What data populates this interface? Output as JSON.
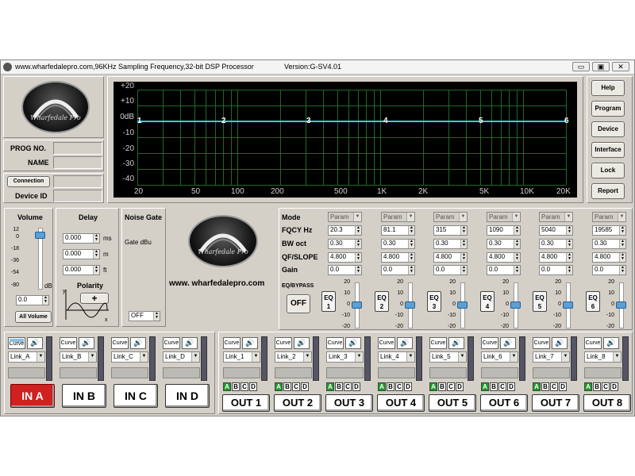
{
  "window": {
    "title": "www.wharfedalepro.com,96KHz Sampling Frequency,32-bit DSP Processor",
    "version": "Version:G-SV4.01",
    "controls": [
      "▭",
      "▣",
      "✕"
    ]
  },
  "left_panel": {
    "logo_text": "Wharfedale Pro",
    "prog_no_label": "PROG NO.",
    "name_label": "NAME",
    "connection_label": "Connection",
    "device_id_label": "Device ID"
  },
  "graph": {
    "y_labels": [
      "+20",
      "+10",
      "0dB",
      "-10",
      "-20",
      "-30",
      "-40"
    ],
    "x_labels": [
      "20",
      "50",
      "100",
      "200",
      "500",
      "1K",
      "2K",
      "5K",
      "10K",
      "20K"
    ],
    "nodes": [
      "1",
      "2",
      "3",
      "4",
      "5",
      "6"
    ],
    "line_color": "#3cc8e0",
    "grid_color": "#1c6a2a"
  },
  "right_buttons": [
    "Help",
    "Program",
    "Device",
    "Interface",
    "Lock",
    "Report"
  ],
  "volume": {
    "title": "Volume",
    "ticks": [
      "12",
      "0",
      "-18",
      "-36",
      "-54",
      "-80"
    ],
    "unit": "dB",
    "value": "0.0",
    "all_button": "All Volume",
    "level_db": 0
  },
  "delay": {
    "title": "Delay",
    "rows": [
      {
        "value": "0.000",
        "unit": "ms"
      },
      {
        "value": "0.000",
        "unit": "m"
      },
      {
        "value": "0.000",
        "unit": "ft"
      }
    ],
    "polarity_label": "Polarity",
    "polarity_button": "+"
  },
  "noise_gate": {
    "title": "Noise Gate",
    "label": "Gate  dBu",
    "value": "OFF"
  },
  "center": {
    "logo_text": "Wharfedale Pro",
    "url": "www. wharfedalepro.com"
  },
  "eq": {
    "row_labels": [
      "Mode",
      "FQCY  Hz",
      "BW  oct",
      "QF/SLOPE",
      "Gain"
    ],
    "bypass_label": "EQ/BYPASS",
    "bypass_button": "OFF",
    "gain_ticks": [
      "20",
      "10",
      "0",
      "-10",
      "-20"
    ],
    "bands": [
      {
        "mode": "Param",
        "fqcy": "20.3",
        "bw": "0.30",
        "qf": "4.800",
        "gain": "0.0",
        "button": "EQ\n1",
        "gain_db": 0
      },
      {
        "mode": "Param",
        "fqcy": "81.1",
        "bw": "0.30",
        "qf": "4.800",
        "gain": "0.0",
        "button": "EQ\n2",
        "gain_db": 0
      },
      {
        "mode": "Param",
        "fqcy": "315",
        "bw": "0.30",
        "qf": "4.800",
        "gain": "0.0",
        "button": "EQ\n3",
        "gain_db": 0
      },
      {
        "mode": "Param",
        "fqcy": "1090",
        "bw": "0.30",
        "qf": "4.800",
        "gain": "0.0",
        "button": "EQ\n4",
        "gain_db": 0
      },
      {
        "mode": "Param",
        "fqcy": "5040",
        "bw": "0.30",
        "qf": "4.800",
        "gain": "0.0",
        "button": "EQ\n5",
        "gain_db": 0
      },
      {
        "mode": "Param",
        "fqcy": "19585",
        "bw": "0.30",
        "qf": "4.800",
        "gain": "0.0",
        "button": "EQ\n6",
        "gain_db": 0
      }
    ]
  },
  "inputs": [
    {
      "name": "IN A",
      "link": "Link_A",
      "curve": "Curve",
      "active": true
    },
    {
      "name": "IN B",
      "link": "Link_B",
      "curve": "Curve",
      "active": false
    },
    {
      "name": "IN C",
      "link": "Link_C",
      "curve": "Curve",
      "active": false
    },
    {
      "name": "IN D",
      "link": "Link_D",
      "curve": "Curve",
      "active": false
    }
  ],
  "outputs": [
    {
      "name": "OUT 1",
      "link": "Link_1",
      "curve": "Curve"
    },
    {
      "name": "OUT 2",
      "link": "Link_2",
      "curve": "Curve"
    },
    {
      "name": "OUT 3",
      "link": "Link_3",
      "curve": "Curve"
    },
    {
      "name": "OUT 4",
      "link": "Link_4",
      "curve": "Curve"
    },
    {
      "name": "OUT 5",
      "link": "Link_5",
      "curve": "Curve"
    },
    {
      "name": "OUT 6",
      "link": "Link_6",
      "curve": "Curve"
    },
    {
      "name": "OUT 7",
      "link": "Link_7",
      "curve": "Curve"
    },
    {
      "name": "OUT 8",
      "link": "Link_8",
      "curve": "Curve"
    }
  ],
  "routing_letters": [
    "A",
    "B",
    "C",
    "D"
  ],
  "speaker_icon": "🔊"
}
